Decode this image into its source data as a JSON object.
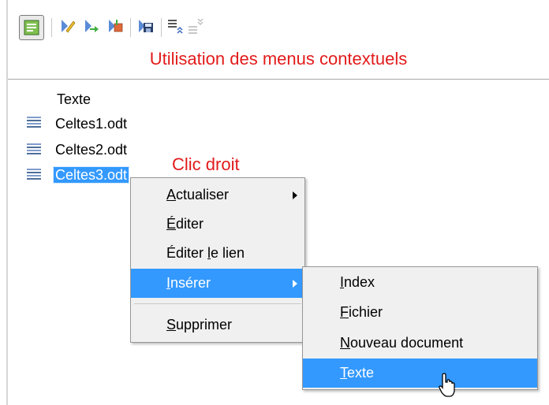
{
  "caption": "Utilisation des menus contextuels",
  "callout": "Clic droit",
  "toolbar": {
    "buttons": [
      "navigator-toggle-icon",
      "edit-pencil-icon",
      "arrow-icon",
      "insert-icon",
      "save-icon",
      "promote-level-icon",
      "demote-level-icon"
    ]
  },
  "tree": {
    "header": "Texte",
    "items": [
      {
        "label": "Celtes1.odt"
      },
      {
        "label": "Celtes2.odt"
      },
      {
        "label": "Celtes3.odt",
        "selected": true
      }
    ]
  },
  "context_menu": {
    "items": [
      {
        "pre": "",
        "u": "A",
        "post": "ctualiser",
        "submenu": true
      },
      {
        "pre": "",
        "u": "É",
        "post": "diter"
      },
      {
        "pre": "Éditer ",
        "u": "l",
        "post": "e lien"
      },
      {
        "pre": "",
        "u": "I",
        "post": "nsérer",
        "submenu": true,
        "highlighted": true
      },
      {
        "pre": "",
        "u": "S",
        "post": "upprimer"
      }
    ]
  },
  "submenu": {
    "items": [
      {
        "pre": "",
        "u": "I",
        "post": "ndex"
      },
      {
        "pre": "",
        "u": "F",
        "post": "ichier"
      },
      {
        "pre": "",
        "u": "N",
        "post": "ouveau document"
      },
      {
        "pre": "",
        "u": "T",
        "post": "exte",
        "highlighted": true
      }
    ]
  },
  "colors": {
    "accent": "#3399ff",
    "annotation": "#e21b1b"
  }
}
